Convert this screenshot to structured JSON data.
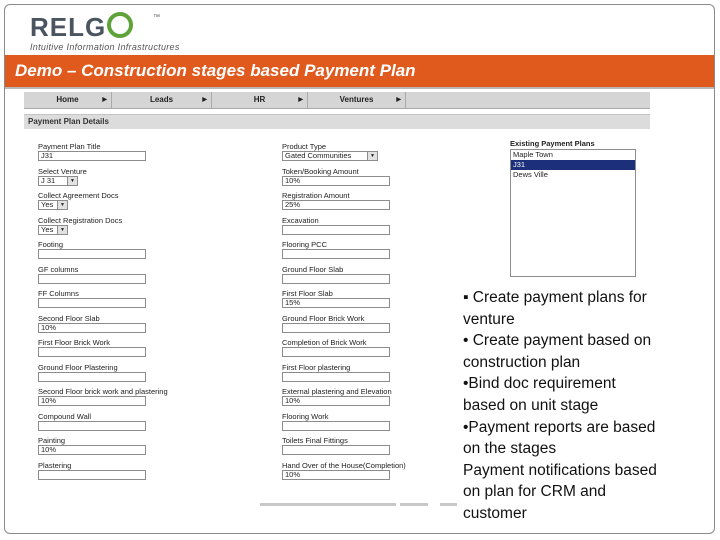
{
  "logo": {
    "word": "RELG",
    "tm": "™",
    "tagline": "Intuitive Information Infrastructures"
  },
  "slide_title": "Demo – Construction stages based Payment Plan",
  "nav": [
    {
      "label": "Home"
    },
    {
      "label": "Leads"
    },
    {
      "label": "HR"
    },
    {
      "label": "Ventures"
    }
  ],
  "section_title": "Payment Plan Details",
  "left_fields": [
    {
      "label": "Payment Plan Title",
      "value": "J31",
      "type": "input"
    },
    {
      "label": "Select Venture",
      "value": "J 31",
      "type": "select"
    },
    {
      "label": "Collect Agreement Docs",
      "value": "Yes",
      "type": "select"
    },
    {
      "label": "Collect Registration Docs",
      "value": "Yes",
      "type": "select"
    },
    {
      "label": "Footing",
      "value": "",
      "type": "input"
    },
    {
      "label": "GF columns",
      "value": "",
      "type": "input"
    },
    {
      "label": "FF Columns",
      "value": "",
      "type": "input"
    },
    {
      "label": "Second Floor Slab",
      "value": "10%",
      "type": "input"
    },
    {
      "label": "First Floor Brick Work",
      "value": "",
      "type": "input"
    },
    {
      "label": "Ground Floor Plastering",
      "value": "",
      "type": "input"
    },
    {
      "label": "Second Floor brick work and plastering",
      "value": "10%",
      "type": "input"
    },
    {
      "label": "Compound Wall",
      "value": "",
      "type": "input"
    },
    {
      "label": "Painting",
      "value": "10%",
      "type": "input"
    },
    {
      "label": "Plastering",
      "value": "",
      "type": "input"
    }
  ],
  "right_fields": [
    {
      "label": "Product Type",
      "value": "Gated Communities",
      "type": "select"
    },
    {
      "label": "Token/Booking Amount",
      "value": "10%",
      "type": "input"
    },
    {
      "label": "Registration Amount",
      "value": "25%",
      "type": "input"
    },
    {
      "label": "Excavation",
      "value": "",
      "type": "input"
    },
    {
      "label": "Flooring PCC",
      "value": "",
      "type": "input"
    },
    {
      "label": "Ground Floor Slab",
      "value": "",
      "type": "input"
    },
    {
      "label": "First Floor Slab",
      "value": "15%",
      "type": "input"
    },
    {
      "label": "Ground Floor Brick Work",
      "value": "",
      "type": "input"
    },
    {
      "label": "Completion of Brick Work",
      "value": "",
      "type": "input"
    },
    {
      "label": "First Floor plastering",
      "value": "",
      "type": "input"
    },
    {
      "label": "External plastering and Elevation",
      "value": "10%",
      "type": "input"
    },
    {
      "label": "Flooring Work",
      "value": "",
      "type": "input"
    },
    {
      "label": "Toilets Final Fittings",
      "value": "",
      "type": "input"
    },
    {
      "label": "Hand Over of the House(Completion)",
      "value": "10%",
      "type": "input"
    }
  ],
  "existing_plans": {
    "label": "Existing Payment Plans",
    "items": [
      "Maple Town",
      "J31",
      "Dews Ville"
    ],
    "selected": "J31"
  },
  "bullets": [
    "▪ Create payment plans for",
    "venture",
    "• Create payment based on",
    "construction plan",
    "•Bind doc requirement",
    "based on unit stage",
    "•Payment reports are based",
    "on the stages",
    "Payment notifications based",
    "on plan for CRM and",
    "customer"
  ],
  "colors": {
    "title_bar": "#e05a1e",
    "logo_accent": "#5fa23a",
    "selected_item": "#1c2f7a"
  }
}
